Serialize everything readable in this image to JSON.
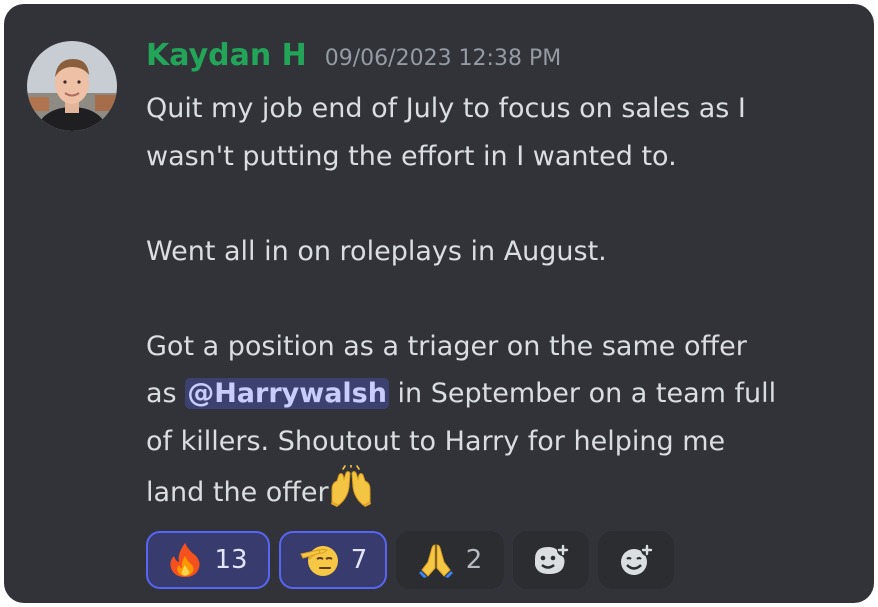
{
  "message": {
    "author": "Kaydan H",
    "timestamp": "09/06/2023 12:38 PM",
    "author_color": "#23a559",
    "content": {
      "line1": "Quit my job end of July to focus on sales as I",
      "line2": "wasn't putting the effort in I wanted to.",
      "line3": "Went all in on roleplays in August.",
      "line4": "Got a position as a triager on the same offer",
      "line5_before": "as ",
      "mention": "@Harrywalsh",
      "line5_after": " in September on a team full",
      "line6": "of killers. Shoutout to Harry for helping me",
      "line7": "land the offer",
      "line7_emoji": "raising-hands-emoji"
    }
  },
  "reactions": [
    {
      "emoji": "fire-emoji",
      "count": "13",
      "reacted_by_me": true
    },
    {
      "emoji": "saluting-face-emoji",
      "count": "7",
      "reacted_by_me": true
    },
    {
      "emoji": "folded-hands-emoji",
      "count": "2",
      "reacted_by_me": false
    },
    {
      "emoji": "add-reaction-icon",
      "count": "",
      "reacted_by_me": false
    },
    {
      "emoji": "add-super-reaction-icon",
      "count": "",
      "reacted_by_me": false
    }
  ],
  "colors": {
    "background": "#313338",
    "text": "#dbdee1",
    "timestamp": "#949ba4",
    "mention_bg": "#3c4270",
    "reaction_active_border": "#5865f2"
  }
}
